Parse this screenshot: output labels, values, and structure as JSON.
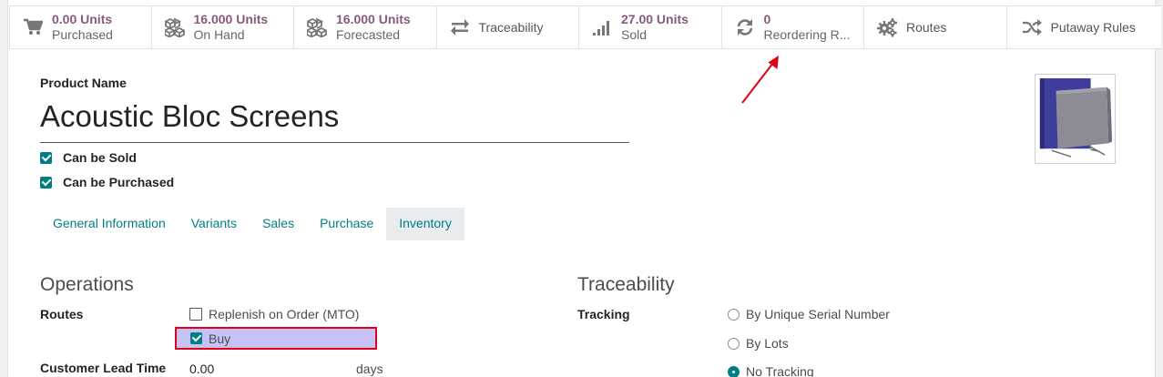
{
  "smart_buttons": [
    {
      "icon": "cart-icon",
      "value": "0.00 Units",
      "text": "Purchased"
    },
    {
      "icon": "cubes-icon",
      "value": "16.000 Units",
      "text": "On Hand"
    },
    {
      "icon": "cubes-icon",
      "value": "16.000 Units",
      "text": "Forecasted"
    },
    {
      "icon": "exchange-icon",
      "label": "Traceability"
    },
    {
      "icon": "signal-icon",
      "value": "27.00 Units",
      "text": "Sold"
    },
    {
      "icon": "refresh-icon",
      "value": "0",
      "text": "Reordering R..."
    },
    {
      "icon": "cogs-icon",
      "label": "Routes"
    },
    {
      "icon": "random-icon",
      "label": "Putaway Rules"
    }
  ],
  "product": {
    "name_label": "Product Name",
    "name": "Acoustic Bloc Screens",
    "can_be_sold_label": "Can be Sold",
    "can_be_sold": true,
    "can_be_purchased_label": "Can be Purchased",
    "can_be_purchased": true
  },
  "tabs": [
    {
      "label": "General Information",
      "active": false
    },
    {
      "label": "Variants",
      "active": false
    },
    {
      "label": "Sales",
      "active": false
    },
    {
      "label": "Purchase",
      "active": false
    },
    {
      "label": "Inventory",
      "active": true
    }
  ],
  "operations": {
    "title": "Operations",
    "routes_label": "Routes",
    "routes": [
      {
        "label": "Replenish on Order (MTO)",
        "checked": false
      },
      {
        "label": "Buy",
        "checked": true
      }
    ],
    "customer_lead_time_label": "Customer Lead Time",
    "customer_lead_time_value": "0.00",
    "customer_lead_time_unit": "days"
  },
  "traceability": {
    "title": "Traceability",
    "tracking_label": "Tracking",
    "options": [
      {
        "label": "By Unique Serial Number",
        "selected": false
      },
      {
        "label": "By Lots",
        "selected": false
      },
      {
        "label": "No Tracking",
        "selected": true
      }
    ]
  },
  "colors": {
    "accent": "#017e84",
    "stat_value": "#875a7b",
    "highlight_border": "#e0001a",
    "highlight_fill": "#c7c2f5",
    "annotation_arrow": "#e0001a"
  }
}
